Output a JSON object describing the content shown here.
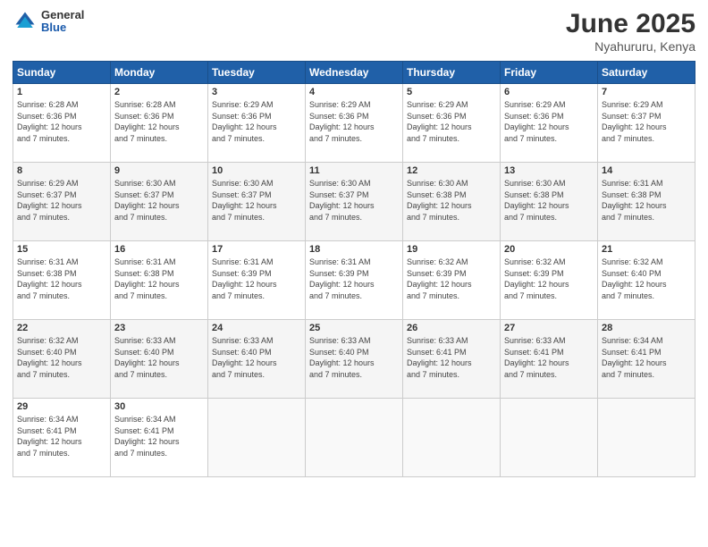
{
  "logo": {
    "general": "General",
    "blue": "Blue"
  },
  "title": "June 2025",
  "subtitle": "Nyahururu, Kenya",
  "headers": [
    "Sunday",
    "Monday",
    "Tuesday",
    "Wednesday",
    "Thursday",
    "Friday",
    "Saturday"
  ],
  "weeks": [
    [
      {
        "day": "1",
        "info": "Sunrise: 6:28 AM\nSunset: 6:36 PM\nDaylight: 12 hours\nand 7 minutes."
      },
      {
        "day": "2",
        "info": "Sunrise: 6:28 AM\nSunset: 6:36 PM\nDaylight: 12 hours\nand 7 minutes."
      },
      {
        "day": "3",
        "info": "Sunrise: 6:29 AM\nSunset: 6:36 PM\nDaylight: 12 hours\nand 7 minutes."
      },
      {
        "day": "4",
        "info": "Sunrise: 6:29 AM\nSunset: 6:36 PM\nDaylight: 12 hours\nand 7 minutes."
      },
      {
        "day": "5",
        "info": "Sunrise: 6:29 AM\nSunset: 6:36 PM\nDaylight: 12 hours\nand 7 minutes."
      },
      {
        "day": "6",
        "info": "Sunrise: 6:29 AM\nSunset: 6:36 PM\nDaylight: 12 hours\nand 7 minutes."
      },
      {
        "day": "7",
        "info": "Sunrise: 6:29 AM\nSunset: 6:37 PM\nDaylight: 12 hours\nand 7 minutes."
      }
    ],
    [
      {
        "day": "8",
        "info": "Sunrise: 6:29 AM\nSunset: 6:37 PM\nDaylight: 12 hours\nand 7 minutes."
      },
      {
        "day": "9",
        "info": "Sunrise: 6:30 AM\nSunset: 6:37 PM\nDaylight: 12 hours\nand 7 minutes."
      },
      {
        "day": "10",
        "info": "Sunrise: 6:30 AM\nSunset: 6:37 PM\nDaylight: 12 hours\nand 7 minutes."
      },
      {
        "day": "11",
        "info": "Sunrise: 6:30 AM\nSunset: 6:37 PM\nDaylight: 12 hours\nand 7 minutes."
      },
      {
        "day": "12",
        "info": "Sunrise: 6:30 AM\nSunset: 6:38 PM\nDaylight: 12 hours\nand 7 minutes."
      },
      {
        "day": "13",
        "info": "Sunrise: 6:30 AM\nSunset: 6:38 PM\nDaylight: 12 hours\nand 7 minutes."
      },
      {
        "day": "14",
        "info": "Sunrise: 6:31 AM\nSunset: 6:38 PM\nDaylight: 12 hours\nand 7 minutes."
      }
    ],
    [
      {
        "day": "15",
        "info": "Sunrise: 6:31 AM\nSunset: 6:38 PM\nDaylight: 12 hours\nand 7 minutes."
      },
      {
        "day": "16",
        "info": "Sunrise: 6:31 AM\nSunset: 6:38 PM\nDaylight: 12 hours\nand 7 minutes."
      },
      {
        "day": "17",
        "info": "Sunrise: 6:31 AM\nSunset: 6:39 PM\nDaylight: 12 hours\nand 7 minutes."
      },
      {
        "day": "18",
        "info": "Sunrise: 6:31 AM\nSunset: 6:39 PM\nDaylight: 12 hours\nand 7 minutes."
      },
      {
        "day": "19",
        "info": "Sunrise: 6:32 AM\nSunset: 6:39 PM\nDaylight: 12 hours\nand 7 minutes."
      },
      {
        "day": "20",
        "info": "Sunrise: 6:32 AM\nSunset: 6:39 PM\nDaylight: 12 hours\nand 7 minutes."
      },
      {
        "day": "21",
        "info": "Sunrise: 6:32 AM\nSunset: 6:40 PM\nDaylight: 12 hours\nand 7 minutes."
      }
    ],
    [
      {
        "day": "22",
        "info": "Sunrise: 6:32 AM\nSunset: 6:40 PM\nDaylight: 12 hours\nand 7 minutes."
      },
      {
        "day": "23",
        "info": "Sunrise: 6:33 AM\nSunset: 6:40 PM\nDaylight: 12 hours\nand 7 minutes."
      },
      {
        "day": "24",
        "info": "Sunrise: 6:33 AM\nSunset: 6:40 PM\nDaylight: 12 hours\nand 7 minutes."
      },
      {
        "day": "25",
        "info": "Sunrise: 6:33 AM\nSunset: 6:40 PM\nDaylight: 12 hours\nand 7 minutes."
      },
      {
        "day": "26",
        "info": "Sunrise: 6:33 AM\nSunset: 6:41 PM\nDaylight: 12 hours\nand 7 minutes."
      },
      {
        "day": "27",
        "info": "Sunrise: 6:33 AM\nSunset: 6:41 PM\nDaylight: 12 hours\nand 7 minutes."
      },
      {
        "day": "28",
        "info": "Sunrise: 6:34 AM\nSunset: 6:41 PM\nDaylight: 12 hours\nand 7 minutes."
      }
    ],
    [
      {
        "day": "29",
        "info": "Sunrise: 6:34 AM\nSunset: 6:41 PM\nDaylight: 12 hours\nand 7 minutes."
      },
      {
        "day": "30",
        "info": "Sunrise: 6:34 AM\nSunset: 6:41 PM\nDaylight: 12 hours\nand 7 minutes."
      },
      {
        "day": "",
        "info": ""
      },
      {
        "day": "",
        "info": ""
      },
      {
        "day": "",
        "info": ""
      },
      {
        "day": "",
        "info": ""
      },
      {
        "day": "",
        "info": ""
      }
    ]
  ]
}
